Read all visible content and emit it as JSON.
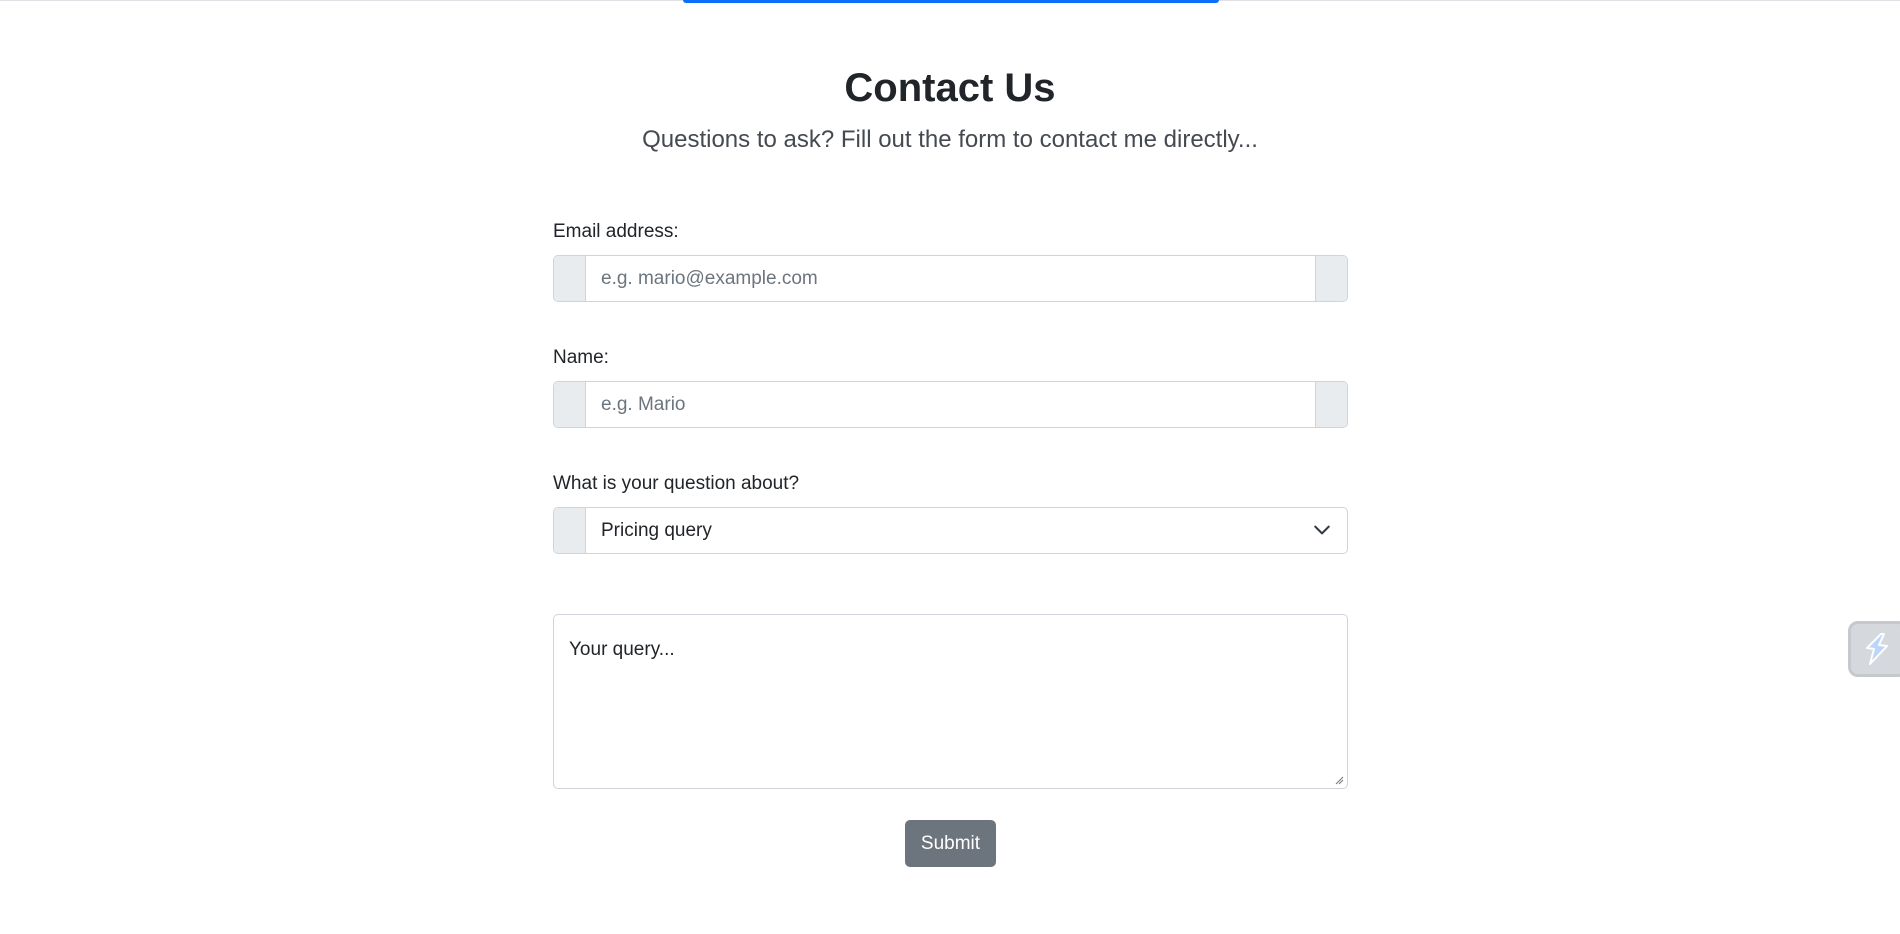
{
  "header": {
    "title": "Contact Us",
    "subtitle": "Questions to ask? Fill out the form to contact me directly..."
  },
  "form": {
    "email": {
      "label": "Email address:",
      "placeholder": "e.g. mario@example.com",
      "value": ""
    },
    "name": {
      "label": "Name:",
      "placeholder": "e.g. Mario",
      "value": ""
    },
    "topic": {
      "label": "What is your question about?",
      "selected": "Pricing query"
    },
    "query": {
      "text": "Your query..."
    },
    "submit_label": "Submit"
  },
  "icons": {
    "select_chevron": "chevron-down-icon",
    "resize_grip": "resize-grip-icon",
    "side_widget": "lightning-icon"
  },
  "colors": {
    "accent": "#0d6efd",
    "button": "#6c757d",
    "addon": "#e9ecef",
    "border": "#ced4da"
  }
}
